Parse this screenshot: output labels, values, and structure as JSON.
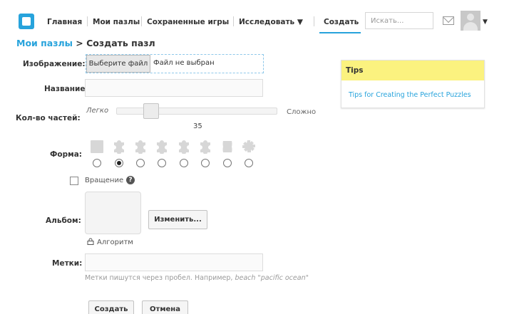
{
  "nav": {
    "items": [
      {
        "label": "Главная"
      },
      {
        "label": "Мои пазлы"
      },
      {
        "label": "Сохраненные игры"
      },
      {
        "label": "Исследовать ▼"
      },
      {
        "label": "Создать"
      }
    ],
    "active": "Создать",
    "search_placeholder": "Искать..."
  },
  "breadcrumb": {
    "link": "Мои пазлы",
    "separator": " > ",
    "current": "Создать пазл"
  },
  "form": {
    "image": {
      "label": "Изображение:",
      "button": "Выберите файл",
      "status": "Файл не выбран"
    },
    "name": {
      "label": "Название:",
      "value": ""
    },
    "pieces": {
      "label": "Кол-во частей:",
      "easy": "Легко",
      "hard": "Сложно",
      "value": "35",
      "position_fraction": 0.2
    },
    "shape": {
      "label": "Форма:",
      "options": [
        "square-icon",
        "puzzle-piece-icon",
        "puzzle-piece-icon",
        "puzzle-piece-icon",
        "puzzle-piece-icon",
        "puzzle-piece-icon",
        "rounded-piece-icon",
        "gear-piece-icon"
      ],
      "selected_index": 1
    },
    "rotation": {
      "label": "Вращение",
      "checked": false
    },
    "album": {
      "label": "Альбом:",
      "change_button": "Изменить...",
      "algorithm_label": "Алгоритм"
    },
    "tags": {
      "label": "Метки:",
      "hint_prefix": "Метки пишутся через пробел. Например, ",
      "hint_example": "beach \"pacific ocean\""
    },
    "buttons": {
      "submit": "Создать",
      "cancel": "Отмена"
    }
  },
  "tips": {
    "title": "Tips",
    "link": "Tips for Creating the Perfect Puzzles"
  },
  "colors": {
    "accent": "#27a3dc",
    "tips_header": "#fbf27f"
  }
}
